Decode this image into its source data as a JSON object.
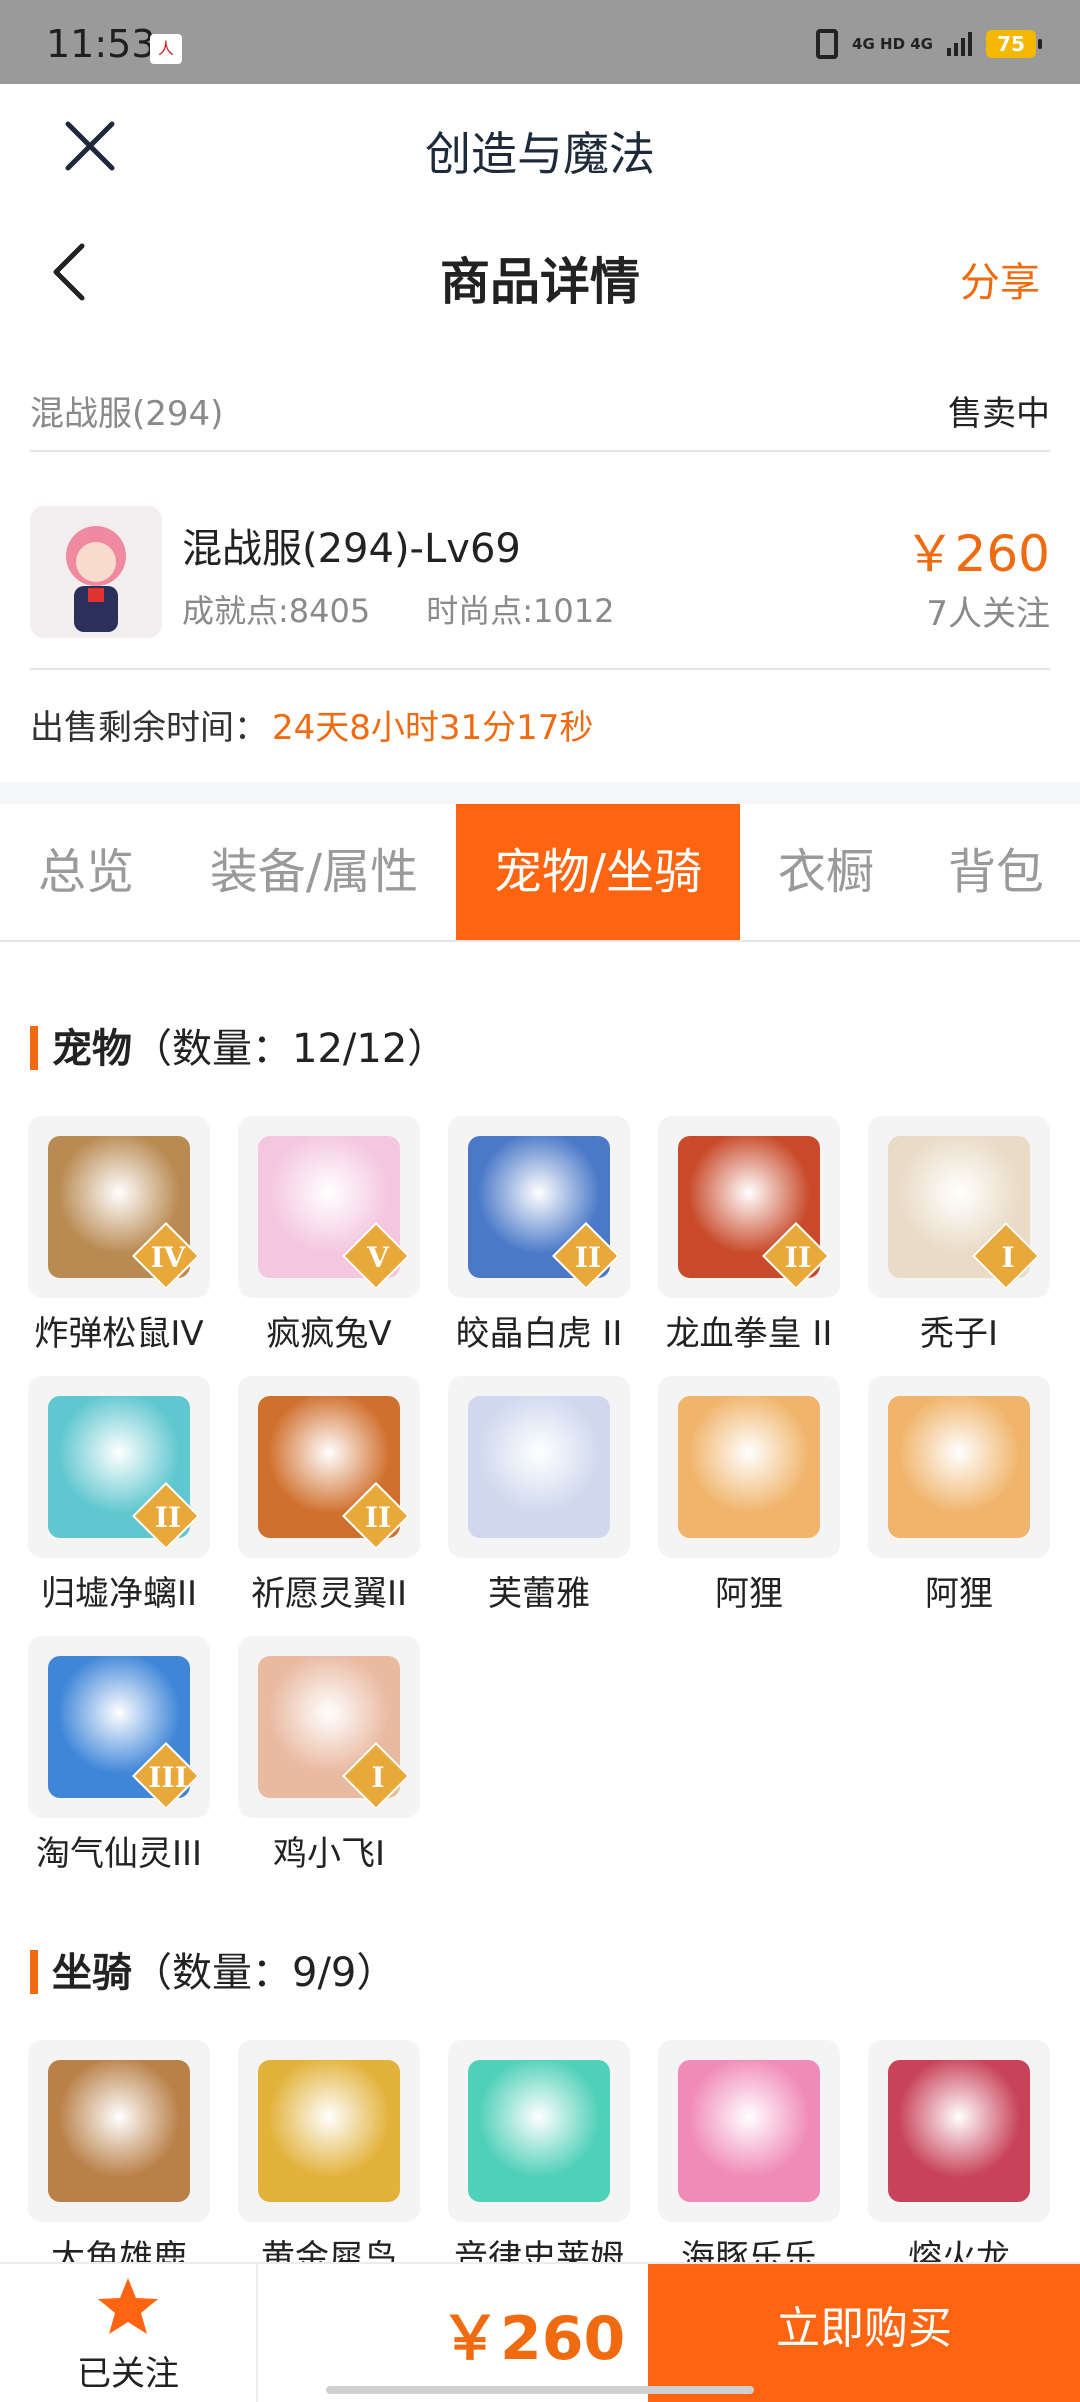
{
  "status_bar": {
    "time": "11:53",
    "network_label": "4G HD 4G",
    "battery": "75"
  },
  "app": {
    "title": "创造与魔法"
  },
  "nav": {
    "title": "商品详情",
    "share": "分享"
  },
  "server": {
    "name": "混战服(294)",
    "status": "售卖中"
  },
  "product": {
    "title": "混战服(294)-Lv69",
    "achievement": "成就点:8405",
    "fashion": "时尚点:1012",
    "price": "￥260",
    "followers": "7人关注"
  },
  "remaining": {
    "label": "出售剩余时间：",
    "value": "24天8小时31分17秒"
  },
  "tabs": [
    {
      "label": "总览",
      "active": false
    },
    {
      "label": "装备/属性",
      "active": false
    },
    {
      "label": "宠物/坐骑",
      "active": true
    },
    {
      "label": "衣橱",
      "active": false
    },
    {
      "label": "背包",
      "active": false
    }
  ],
  "pets": {
    "title": "宠物",
    "count": "（数量：12/12）",
    "items": [
      {
        "name": "炸弹松鼠IV",
        "rank": "IV",
        "color": "#b98a52"
      },
      {
        "name": "疯疯兔V",
        "rank": "V",
        "color": "#f4c6e0"
      },
      {
        "name": "皎晶白虎 II",
        "rank": "II",
        "color": "#4b79c8"
      },
      {
        "name": "龙血拳皇 II",
        "rank": "II",
        "color": "#c84a2a"
      },
      {
        "name": "秃子I",
        "rank": "I",
        "color": "#eadbc6"
      },
      {
        "name": "归墟净螭II",
        "rank": "II",
        "color": "#5fc7cf"
      },
      {
        "name": "祈愿灵翼II",
        "rank": "II",
        "color": "#d0702e"
      },
      {
        "name": "芙蕾雅",
        "rank": "",
        "color": "#cfd8ef"
      },
      {
        "name": "阿狸",
        "rank": "",
        "color": "#f0b46a"
      },
      {
        "name": "阿狸",
        "rank": "",
        "color": "#f0b46a"
      },
      {
        "name": "淘气仙灵III",
        "rank": "III",
        "color": "#3f86d8"
      },
      {
        "name": "鸡小飞I",
        "rank": "I",
        "color": "#e9b9a0"
      }
    ]
  },
  "mounts": {
    "title": "坐骑",
    "count": "（数量：9/9）",
    "items": [
      {
        "name": "大角雄鹿",
        "color": "#b98048"
      },
      {
        "name": "黄金犀鸟",
        "color": "#e2b23a"
      },
      {
        "name": "音律史莱姆",
        "color": "#4fd0b8"
      },
      {
        "name": "海豚乐乐",
        "color": "#f08ab8"
      },
      {
        "name": "熔火龙",
        "color": "#c8435a"
      }
    ]
  },
  "bottom": {
    "follow_label": "已关注",
    "price": "￥260",
    "buy_label": "立即购买"
  },
  "colors": {
    "accent": "#ff6410",
    "price": "#f06a0f"
  }
}
